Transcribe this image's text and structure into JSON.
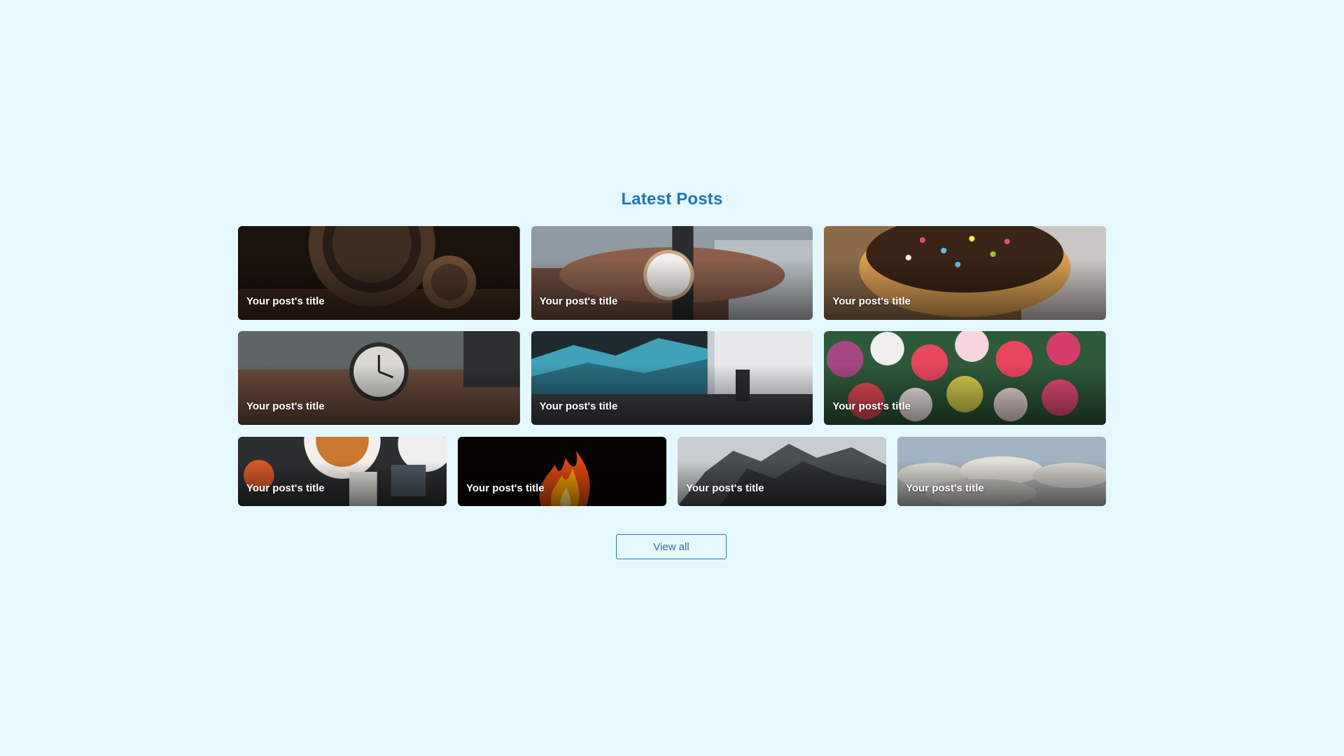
{
  "section": {
    "title": "Latest Posts"
  },
  "posts": [
    {
      "title": "Your post's title",
      "image": "pocket-watch-on-wood"
    },
    {
      "title": "Your post's title",
      "image": "wristwatch-on-arm"
    },
    {
      "title": "Your post's title",
      "image": "sprinkled-donuts"
    },
    {
      "title": "Your post's title",
      "image": "alarm-clock-on-bench"
    },
    {
      "title": "Your post's title",
      "image": "desk-with-monitor"
    },
    {
      "title": "Your post's title",
      "image": "tulip-bouquet"
    },
    {
      "title": "Your post's title",
      "image": "food-table-top-view"
    },
    {
      "title": "Your post's title",
      "image": "fire-flames"
    },
    {
      "title": "Your post's title",
      "image": "rocky-mountain"
    },
    {
      "title": "Your post's title",
      "image": "clouds-sky"
    }
  ],
  "actions": {
    "view_all_label": "View all"
  },
  "colors": {
    "background": "#e5f8fe",
    "accent": "#1f74b3"
  }
}
